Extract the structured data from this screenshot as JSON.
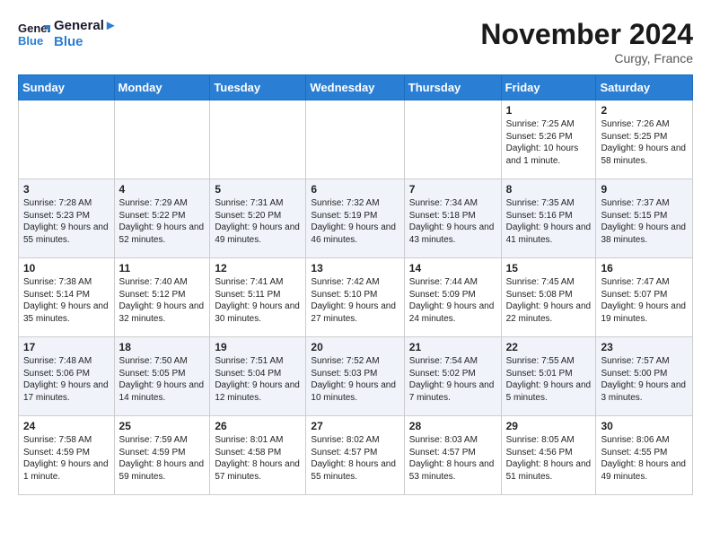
{
  "header": {
    "logo_line1": "General",
    "logo_line2": "Blue",
    "month_title": "November 2024",
    "location": "Curgy, France"
  },
  "weekdays": [
    "Sunday",
    "Monday",
    "Tuesday",
    "Wednesday",
    "Thursday",
    "Friday",
    "Saturday"
  ],
  "weeks": [
    [
      {
        "day": "",
        "info": ""
      },
      {
        "day": "",
        "info": ""
      },
      {
        "day": "",
        "info": ""
      },
      {
        "day": "",
        "info": ""
      },
      {
        "day": "",
        "info": ""
      },
      {
        "day": "1",
        "info": "Sunrise: 7:25 AM\nSunset: 5:26 PM\nDaylight: 10 hours and 1 minute."
      },
      {
        "day": "2",
        "info": "Sunrise: 7:26 AM\nSunset: 5:25 PM\nDaylight: 9 hours and 58 minutes."
      }
    ],
    [
      {
        "day": "3",
        "info": "Sunrise: 7:28 AM\nSunset: 5:23 PM\nDaylight: 9 hours and 55 minutes."
      },
      {
        "day": "4",
        "info": "Sunrise: 7:29 AM\nSunset: 5:22 PM\nDaylight: 9 hours and 52 minutes."
      },
      {
        "day": "5",
        "info": "Sunrise: 7:31 AM\nSunset: 5:20 PM\nDaylight: 9 hours and 49 minutes."
      },
      {
        "day": "6",
        "info": "Sunrise: 7:32 AM\nSunset: 5:19 PM\nDaylight: 9 hours and 46 minutes."
      },
      {
        "day": "7",
        "info": "Sunrise: 7:34 AM\nSunset: 5:18 PM\nDaylight: 9 hours and 43 minutes."
      },
      {
        "day": "8",
        "info": "Sunrise: 7:35 AM\nSunset: 5:16 PM\nDaylight: 9 hours and 41 minutes."
      },
      {
        "day": "9",
        "info": "Sunrise: 7:37 AM\nSunset: 5:15 PM\nDaylight: 9 hours and 38 minutes."
      }
    ],
    [
      {
        "day": "10",
        "info": "Sunrise: 7:38 AM\nSunset: 5:14 PM\nDaylight: 9 hours and 35 minutes."
      },
      {
        "day": "11",
        "info": "Sunrise: 7:40 AM\nSunset: 5:12 PM\nDaylight: 9 hours and 32 minutes."
      },
      {
        "day": "12",
        "info": "Sunrise: 7:41 AM\nSunset: 5:11 PM\nDaylight: 9 hours and 30 minutes."
      },
      {
        "day": "13",
        "info": "Sunrise: 7:42 AM\nSunset: 5:10 PM\nDaylight: 9 hours and 27 minutes."
      },
      {
        "day": "14",
        "info": "Sunrise: 7:44 AM\nSunset: 5:09 PM\nDaylight: 9 hours and 24 minutes."
      },
      {
        "day": "15",
        "info": "Sunrise: 7:45 AM\nSunset: 5:08 PM\nDaylight: 9 hours and 22 minutes."
      },
      {
        "day": "16",
        "info": "Sunrise: 7:47 AM\nSunset: 5:07 PM\nDaylight: 9 hours and 19 minutes."
      }
    ],
    [
      {
        "day": "17",
        "info": "Sunrise: 7:48 AM\nSunset: 5:06 PM\nDaylight: 9 hours and 17 minutes."
      },
      {
        "day": "18",
        "info": "Sunrise: 7:50 AM\nSunset: 5:05 PM\nDaylight: 9 hours and 14 minutes."
      },
      {
        "day": "19",
        "info": "Sunrise: 7:51 AM\nSunset: 5:04 PM\nDaylight: 9 hours and 12 minutes."
      },
      {
        "day": "20",
        "info": "Sunrise: 7:52 AM\nSunset: 5:03 PM\nDaylight: 9 hours and 10 minutes."
      },
      {
        "day": "21",
        "info": "Sunrise: 7:54 AM\nSunset: 5:02 PM\nDaylight: 9 hours and 7 minutes."
      },
      {
        "day": "22",
        "info": "Sunrise: 7:55 AM\nSunset: 5:01 PM\nDaylight: 9 hours and 5 minutes."
      },
      {
        "day": "23",
        "info": "Sunrise: 7:57 AM\nSunset: 5:00 PM\nDaylight: 9 hours and 3 minutes."
      }
    ],
    [
      {
        "day": "24",
        "info": "Sunrise: 7:58 AM\nSunset: 4:59 PM\nDaylight: 9 hours and 1 minute."
      },
      {
        "day": "25",
        "info": "Sunrise: 7:59 AM\nSunset: 4:59 PM\nDaylight: 8 hours and 59 minutes."
      },
      {
        "day": "26",
        "info": "Sunrise: 8:01 AM\nSunset: 4:58 PM\nDaylight: 8 hours and 57 minutes."
      },
      {
        "day": "27",
        "info": "Sunrise: 8:02 AM\nSunset: 4:57 PM\nDaylight: 8 hours and 55 minutes."
      },
      {
        "day": "28",
        "info": "Sunrise: 8:03 AM\nSunset: 4:57 PM\nDaylight: 8 hours and 53 minutes."
      },
      {
        "day": "29",
        "info": "Sunrise: 8:05 AM\nSunset: 4:56 PM\nDaylight: 8 hours and 51 minutes."
      },
      {
        "day": "30",
        "info": "Sunrise: 8:06 AM\nSunset: 4:55 PM\nDaylight: 8 hours and 49 minutes."
      }
    ]
  ]
}
